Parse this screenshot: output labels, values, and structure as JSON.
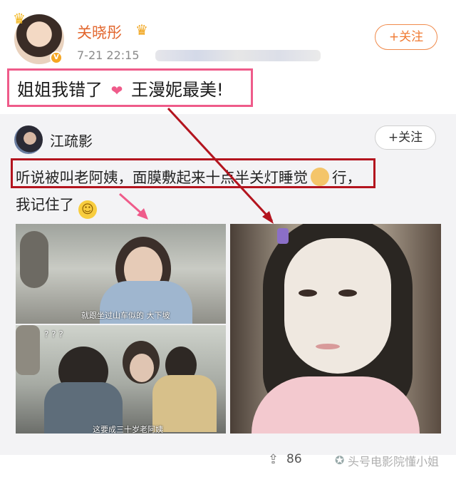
{
  "post": {
    "username": "关晓彤",
    "timestamp": "7-21 22:15",
    "follow_label": "+关注",
    "text_before": "姐姐我错了",
    "text_after": "王漫妮最美!",
    "verified_badge": "V"
  },
  "forward": {
    "username": "江疏影",
    "follow_label": "+关注",
    "line1_text": "听说被叫老阿姨，面膜敷起来十点半关灯睡觉",
    "line1_tail": "行，",
    "line2_text": "我记住了",
    "image1_subtitle": "就跟坐过山车似的 大下坡",
    "image2_marks": "? ? ?",
    "image2_subtitle": "这要成三十岁老阿姨"
  },
  "footer": {
    "share_count": "86",
    "watermark": "头号电影院懂小姐"
  },
  "colors": {
    "username_orange": "#e2662d",
    "highlight_pink": "#ef5b8a",
    "highlight_red": "#b3141e",
    "forward_bg": "#f3f3f5"
  },
  "icons": [
    "crown-icon",
    "vip-crown-icon",
    "heart-emoji-icon",
    "dog-emoji-icon",
    "smile-emoji-icon",
    "share-icon",
    "wechat-icon"
  ]
}
